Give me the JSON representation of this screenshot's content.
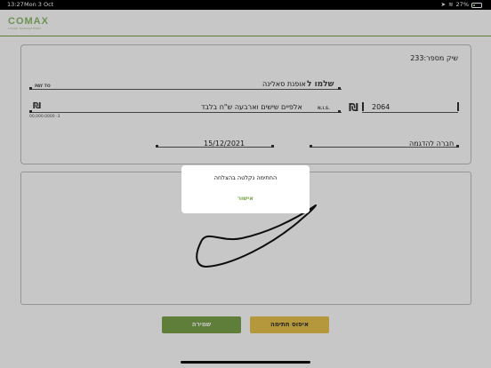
{
  "status_bar": {
    "time": "13:27",
    "date": "Mon 3 Oct",
    "battery": "27%",
    "battery_level": 0.27
  },
  "header": {
    "logo_name": "COMAX",
    "logo_tagline": "STORE MANAGEMENT"
  },
  "check": {
    "check_number_label": "שיק מספר:233",
    "payee_label": "שלמו ל",
    "pay_to_label": "PAY TO",
    "payee_name": "אופנת סאלינה",
    "amount_words": "אלפיים שישים וארבעה ש\"ח בלבד",
    "nis_label": "N.I.S.",
    "currency_symbol": "₪",
    "amount_number": "2064",
    "amount_placeholder": "00,000.0000 -3",
    "date": "15/12/2021",
    "company_name": "חברה להדגמה"
  },
  "buttons": {
    "save_label": "שמירה",
    "reset_label": "איפוס חתימה"
  },
  "dialog": {
    "message": "החתימה נקלטה בהצלחה",
    "ok_label": "אישור"
  },
  "colors": {
    "accent_green": "#7aa24a",
    "accent_yellow": "#e8c24d"
  }
}
